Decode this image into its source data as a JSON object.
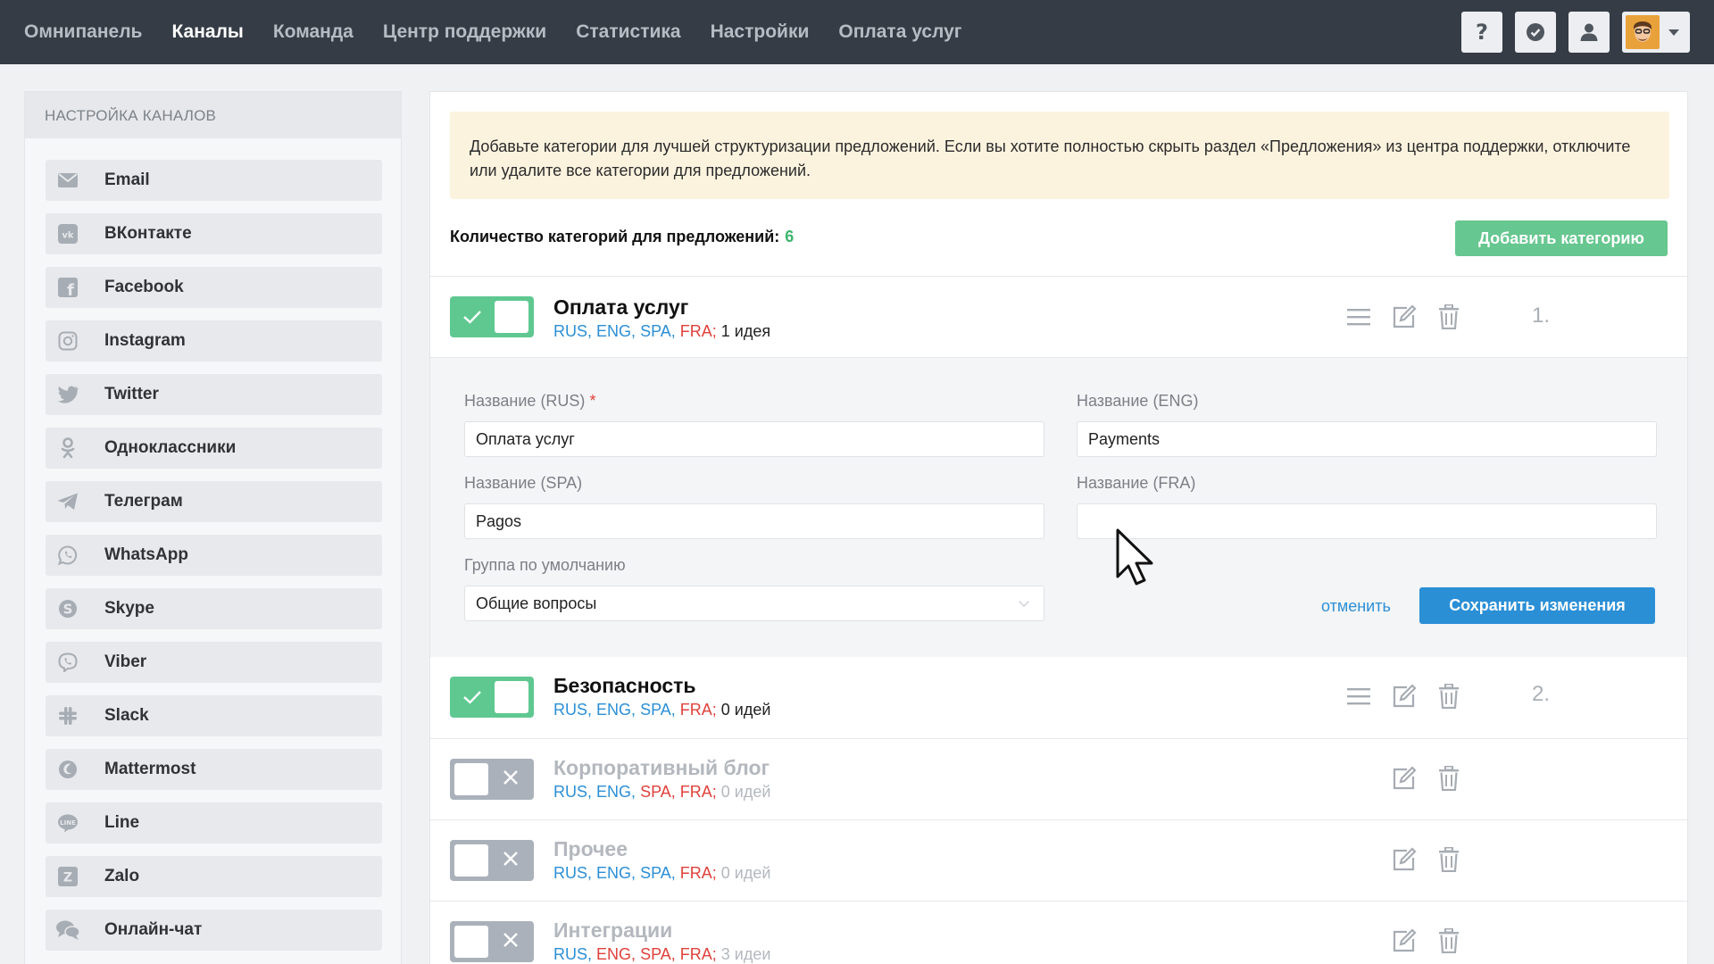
{
  "nav": {
    "items": [
      "Омнипанель",
      "Каналы",
      "Команда",
      "Центр поддержки",
      "Статистика",
      "Настройки",
      "Оплата услуг"
    ],
    "active": "Каналы"
  },
  "top_actions": [
    "help-icon",
    "check-badge-icon",
    "user-icon",
    "avatar"
  ],
  "sidebar": {
    "title": "НАСТРОЙКА КАНАЛОВ",
    "items": [
      {
        "label": "Email",
        "icon": "email-icon"
      },
      {
        "label": "ВКонтакте",
        "icon": "vk-icon"
      },
      {
        "label": "Facebook",
        "icon": "facebook-icon"
      },
      {
        "label": "Instagram",
        "icon": "instagram-icon"
      },
      {
        "label": "Twitter",
        "icon": "twitter-icon"
      },
      {
        "label": "Одноклассники",
        "icon": "odnoklassniki-icon"
      },
      {
        "label": "Телеграм",
        "icon": "telegram-icon"
      },
      {
        "label": "WhatsApp",
        "icon": "whatsapp-icon"
      },
      {
        "label": "Skype",
        "icon": "skype-icon"
      },
      {
        "label": "Viber",
        "icon": "viber-icon"
      },
      {
        "label": "Slack",
        "icon": "slack-icon"
      },
      {
        "label": "Mattermost",
        "icon": "mattermost-icon"
      },
      {
        "label": "Line",
        "icon": "line-icon"
      },
      {
        "label": "Zalo",
        "icon": "zalo-icon"
      },
      {
        "label": "Онлайн-чат",
        "icon": "chat-icon"
      }
    ]
  },
  "main": {
    "notice": "Добавьте категории для лучшей структуризации предложений. Если вы хотите полностью скрыть раздел «Предложения» из центра поддержки, отключите или удалите все категории для предложений.",
    "count_label": "Количество категорий для предложений:",
    "count_value": "6",
    "add_button": "Добавить категорию",
    "langs": [
      "RUS",
      "ENG",
      "SPA",
      "FRA"
    ],
    "categories": [
      {
        "name": "Оплата услуг",
        "enabled": true,
        "ideas": "1 идея",
        "order": "1.",
        "lang_status": [
          "ok",
          "ok",
          "ok",
          "missing"
        ]
      },
      {
        "name": "Безопасность",
        "enabled": true,
        "ideas": "0 идей",
        "order": "2.",
        "lang_status": [
          "ok",
          "ok",
          "ok",
          "missing"
        ]
      },
      {
        "name": "Корпоративный блог",
        "enabled": false,
        "ideas": "0 идей",
        "order": "",
        "lang_status": [
          "ok",
          "ok",
          "missing",
          "missing"
        ]
      },
      {
        "name": "Прочее",
        "enabled": false,
        "ideas": "0 идей",
        "order": "",
        "lang_status": [
          "ok",
          "ok",
          "ok",
          "missing"
        ]
      },
      {
        "name": "Интеграции",
        "enabled": false,
        "ideas": "3 идеи",
        "order": "",
        "lang_status": [
          "ok",
          "missing",
          "missing",
          "missing"
        ]
      }
    ],
    "edit_form": {
      "label_rus": "Название (RUS)",
      "required_mark": "*",
      "value_rus": "Оплата услуг",
      "label_eng": "Название (ENG)",
      "value_eng": "Payments",
      "label_spa": "Название (SPA)",
      "value_spa": "Pagos",
      "label_fra": "Название (FRA)",
      "value_fra": "",
      "label_group": "Группа по умолчанию",
      "value_group": "Общие вопросы",
      "cancel": "отменить",
      "save": "Сохранить изменения"
    }
  },
  "colors": {
    "topbar": "#353c45",
    "toggle_on": "#5fc891",
    "toggle_off": "#aab1ba",
    "link_blue": "#2b8fd6",
    "missing_red": "#e0413b",
    "count_green": "#3cb56c",
    "notice_bg": "#fcf3df"
  }
}
